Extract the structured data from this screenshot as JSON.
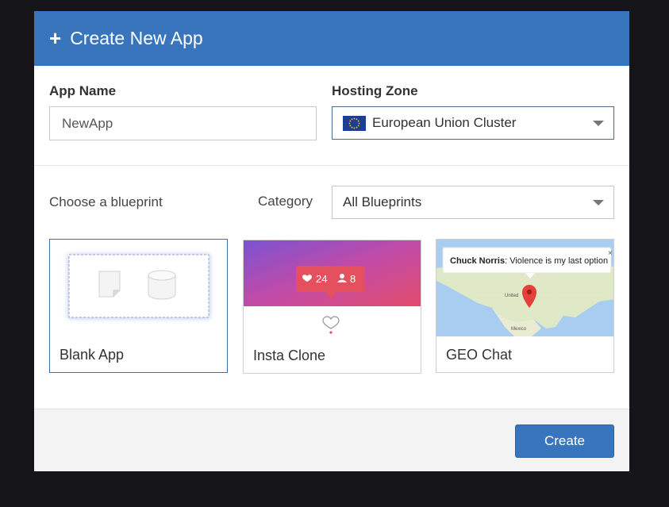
{
  "dialog": {
    "title": "Create New App"
  },
  "form": {
    "app_name_label": "App Name",
    "app_name_value": "NewApp",
    "hosting_zone_label": "Hosting Zone",
    "hosting_zone_value": "European Union Cluster"
  },
  "blueprints": {
    "choose_label": "Choose a blueprint",
    "category_label": "Category",
    "category_value": "All Blueprints",
    "cards": [
      {
        "label": "Blank App",
        "selected": true
      },
      {
        "label": "Insta Clone",
        "likes": "24",
        "followers": "8"
      },
      {
        "label": "GEO Chat",
        "popup_name": "Chuck Norris",
        "popup_text": ": Violence is my last option",
        "map_label_1": "United",
        "map_label_2": "Mexico"
      }
    ]
  },
  "footer": {
    "create_label": "Create"
  },
  "colors": {
    "accent": "#3875bd",
    "background": "#141419"
  }
}
